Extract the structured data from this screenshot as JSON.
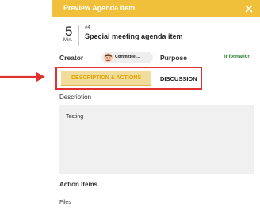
{
  "header": {
    "title": "Preview Agenda Item",
    "close_icon": "close-icon",
    "background": "#f0c03a"
  },
  "item": {
    "duration_value": "5",
    "duration_unit": "Min.",
    "number": "#4",
    "title": "Special meeting agenda item"
  },
  "meta": {
    "creator_label": "Creator",
    "creator_chip": "Committee ...",
    "purpose_label": "Purpose",
    "purpose_value": "Information",
    "purpose_color": "#2e7d32"
  },
  "tabs": [
    {
      "label": "DESCRIPTION & ACTIONS",
      "active": true
    },
    {
      "label": "DISCUSSION",
      "active": false
    }
  ],
  "description": {
    "label": "Description",
    "text": "Testing"
  },
  "sections": {
    "action_items": "Action Items",
    "files": "Files"
  },
  "annotation": {
    "highlight_color": "#e03030"
  }
}
